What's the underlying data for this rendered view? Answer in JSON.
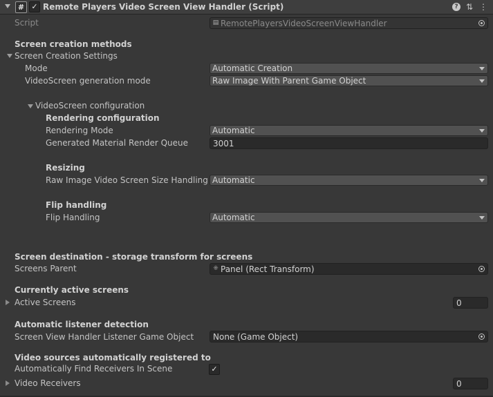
{
  "header": {
    "title": "Remote Players Video Screen View Handler (Script)",
    "script_icon_glyph": "#",
    "enabled_check": "✓",
    "help_icon": "?",
    "settings_icon": "⇅",
    "menu_icon": "⋮"
  },
  "script_row": {
    "label": "Script",
    "value": "RemotePlayersVideoScreenViewHandler"
  },
  "creation": {
    "section_title": "Screen creation methods",
    "foldout_label": "Screen Creation Settings",
    "mode": {
      "label": "Mode",
      "value": "Automatic Creation"
    },
    "generation_mode": {
      "label": "VideoScreen generation mode",
      "value": "Raw Image With Parent Game Object"
    }
  },
  "videoscreen_config": {
    "foldout_label": "VideoScreen configuration",
    "rendering_title": "Rendering configuration",
    "rendering_mode": {
      "label": "Rendering Mode",
      "value": "Automatic"
    },
    "render_queue": {
      "label": "Generated Material Render Queue",
      "value": "3001"
    },
    "resizing_title": "Resizing",
    "size_handling": {
      "label": "Raw Image Video Screen Size Handling",
      "value": "Automatic"
    },
    "flip_title": "Flip handling",
    "flip_handling": {
      "label": "Flip Handling",
      "value": "Automatic"
    }
  },
  "destination": {
    "section_title": "Screen destination - storage transform for screens",
    "screens_parent": {
      "label": "Screens Parent",
      "value": "Panel (Rect Transform)"
    }
  },
  "active": {
    "section_title": "Currently active screens",
    "active_screens": {
      "label": "Active Screens",
      "value": "0"
    }
  },
  "listener": {
    "section_title": "Automatic listener detection",
    "listener_object": {
      "label": "Screen View Handler Listener Game Object",
      "value": "None (Game Object)"
    }
  },
  "sources": {
    "section_title": "Video sources automatically registered to",
    "find_receivers": {
      "label": "Automatically Find Receivers In Scene",
      "checked_glyph": "✓"
    },
    "video_receivers": {
      "label": "Video Receivers",
      "value": "0"
    }
  }
}
